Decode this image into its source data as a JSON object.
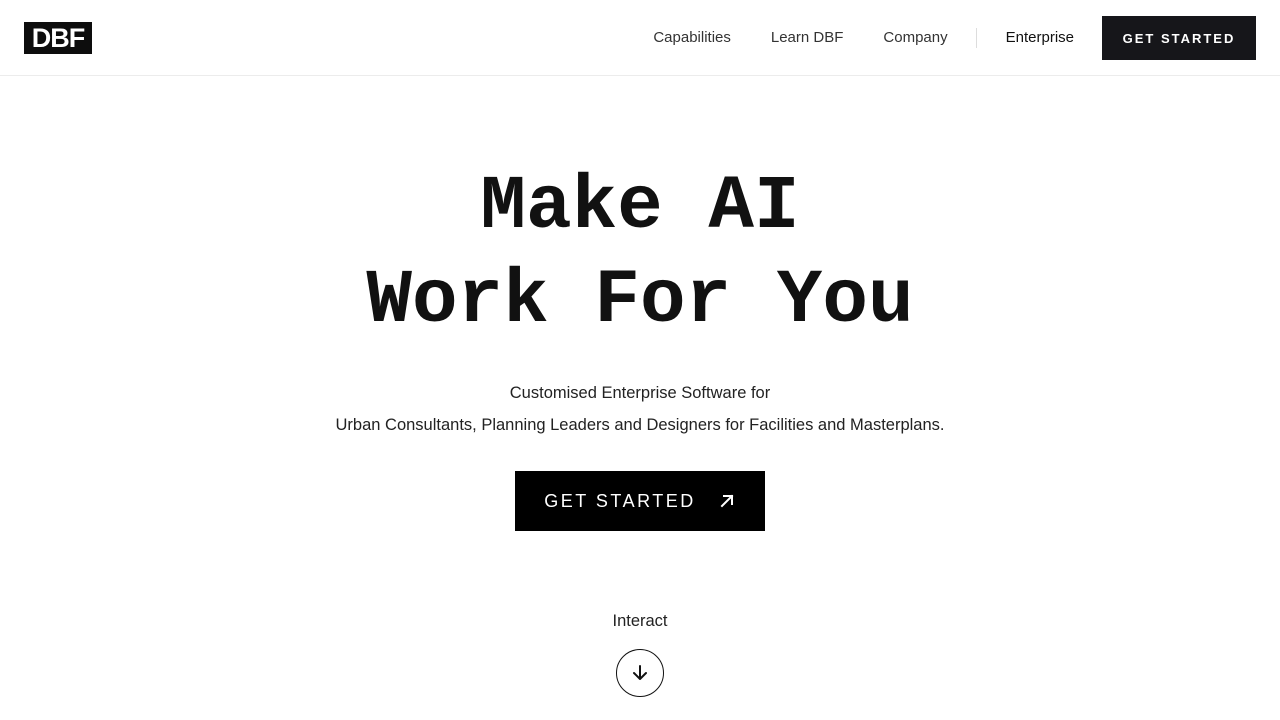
{
  "header": {
    "logo": "DBF",
    "nav": [
      {
        "label": "Capabilities"
      },
      {
        "label": "Learn DBF"
      },
      {
        "label": "Company"
      }
    ],
    "enterprise_label": "Enterprise",
    "cta_label": "GET STARTED"
  },
  "hero": {
    "title_line1": "Make AI",
    "title_line2": "Work For You",
    "subtitle_line1": "Customised Enterprise Software for",
    "subtitle_line2": "Urban Consultants, Planning Leaders and Designers for Facilities and Masterplans.",
    "cta_label": "GET STARTED",
    "cta_icon": "arrow-up-right-icon"
  },
  "interact": {
    "label": "Interact",
    "icon": "arrow-down-icon"
  },
  "colors": {
    "background": "#ffffff",
    "text": "#111111",
    "button_dark": "#16161a",
    "cta_black": "#000000"
  }
}
